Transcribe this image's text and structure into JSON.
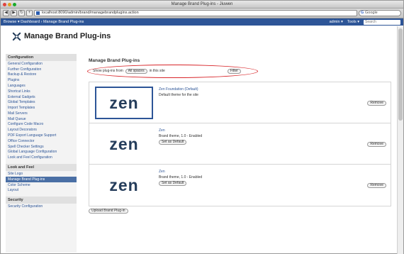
{
  "browser": {
    "window_title": "Manage Brand Plug-ins - Jiuwen",
    "url": "localhost:8090/admin/brand/managebrandplugins.action",
    "search_placeholder": "Google",
    "search_g": "G"
  },
  "app": {
    "nav_left": "Browse ▾   Dashboard  ›  Manage Brand Plug-ins",
    "nav_user": "admin ▾",
    "nav_admin": "Tools ▾",
    "nav_search_placeholder": "Search"
  },
  "page": {
    "title": "Manage Brand Plug-ins"
  },
  "sidebar": {
    "sections": [
      {
        "heading": "Configuration",
        "items": [
          "General Configuration",
          "Further Configuration",
          "Backup & Restore",
          "Plugins",
          "Languages",
          "Shortcut Links",
          "External Gadgets",
          "Global Templates",
          "Import Templates",
          "Mail Servers",
          "Mail Queue",
          "Configure Code Macro",
          "Layout Decorators",
          "PDF Export Language Support",
          "Office Connector",
          "Spell Checker Settings",
          "Global Language Configuration",
          "Look and Feel Configuration"
        ]
      },
      {
        "heading": "Look and Feel",
        "items": [
          "Site Logo",
          "Manage Brand Plug-ins",
          "Color Scheme",
          "Layout"
        ],
        "active_index": 1
      },
      {
        "heading": "Security",
        "items": [
          "Security Configuration"
        ]
      }
    ]
  },
  "main": {
    "heading": "Manage Brand Plug-ins",
    "filter_label": "Show plug-ins from",
    "filter_value": "All spaces",
    "filter_suffix": "in this site",
    "filter_button": "Filter",
    "plugins": [
      {
        "logo_text": "zen",
        "name": "Zen Foundation (Default)",
        "desc": "Default theme for the site",
        "action": "",
        "remove": "Remove"
      },
      {
        "logo_text": "zen",
        "name": "Zen",
        "desc": "Brand theme, 1.0 - Enabled",
        "action": "Set as Default",
        "remove": "Remove"
      },
      {
        "logo_text": "zen",
        "name": "Zen",
        "desc": "Brand theme, 1.0 - Enabled",
        "action": "Set as Default",
        "remove": "Remove"
      }
    ],
    "add_button": "Upload Brand Plug-in"
  },
  "colors": {
    "nav": "#2d5597",
    "highlight": "#d8262a",
    "logo": "#253d5b"
  }
}
